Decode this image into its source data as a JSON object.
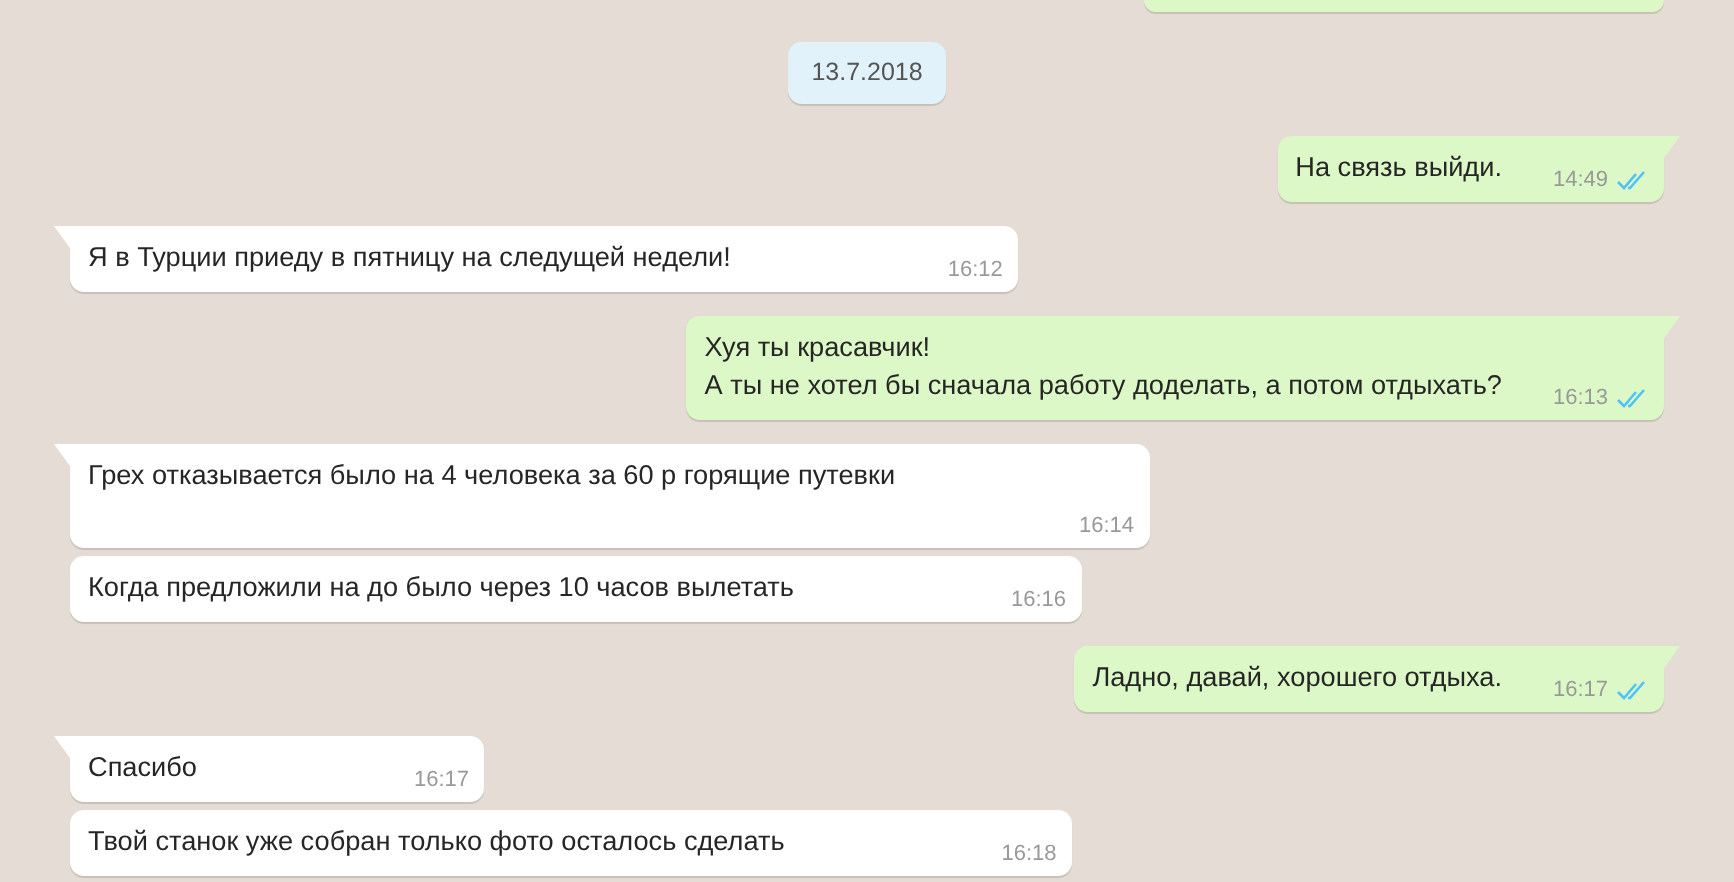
{
  "messages": [
    {
      "kind": "partial_outgoing"
    },
    {
      "kind": "date",
      "text": "13.7.2018"
    },
    {
      "kind": "outgoing",
      "tail": true,
      "lines": [
        "На связь выйди."
      ],
      "time": "14:49",
      "read": true
    },
    {
      "kind": "incoming",
      "tail": true,
      "lines": [
        "Я в Турции приеду в пятницу на следущей недели!"
      ],
      "time": "16:12"
    },
    {
      "kind": "outgoing",
      "tail": true,
      "lines": [
        "Хуя ты красавчик!",
        "А ты не хотел бы сначала работу доделать, а потом отдыхать?"
      ],
      "time": "16:13",
      "read": true
    },
    {
      "kind": "incoming",
      "tail": true,
      "lines": [
        "Грех отказывается было на 4 человека за 60 р горящие путевки"
      ],
      "time": "16:14"
    },
    {
      "kind": "incoming",
      "tail": false,
      "lines": [
        "Когда предложили на до было через 10 часов вылетать"
      ],
      "time": "16:16"
    },
    {
      "kind": "outgoing",
      "tail": true,
      "lines": [
        "Ладно, давай, хорошего отдыха."
      ],
      "time": "16:17",
      "read": true
    },
    {
      "kind": "incoming",
      "tail": true,
      "lines": [
        "Спасибо"
      ],
      "time": "16:17"
    },
    {
      "kind": "incoming",
      "tail": false,
      "lines": [
        "Твой станок уже собран только фото осталось сделать"
      ],
      "time": "16:18"
    }
  ]
}
